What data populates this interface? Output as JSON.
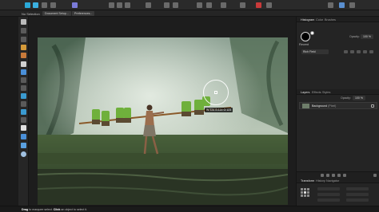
{
  "toolbar": {
    "icons": [
      "photo-persona-icon",
      "liquify-persona-icon",
      "develop-persona-icon",
      "tone-mapping-persona-icon",
      "export-persona-icon"
    ],
    "accent_color": "#2aa9d8"
  },
  "context": {
    "selection_label": "No Selection",
    "document_setup_label": "Document Setup...",
    "preferences_label": "Preferences..."
  },
  "canvas": {
    "brush_readout": "W:334 B:114 G:123"
  },
  "color_panel": {
    "tabs": [
      "Histogram",
      "Color",
      "Brushes"
    ],
    "opacity_label": "Opacity:",
    "opacity_value": "100 %",
    "recent_label": "Recent",
    "palette_name": "Rich Field"
  },
  "layers_panel": {
    "tabs": [
      "Layers",
      "Effects",
      "Styles"
    ],
    "opacity_label": "Opacity:",
    "opacity_value": "100 %",
    "layer_name": "Background",
    "layer_kind": "(Pixel)"
  },
  "transform_panel": {
    "tabs": [
      "Transform",
      "History",
      "Navigator"
    ]
  },
  "status": {
    "drag": "Drag",
    "drag_desc": "to marquee select.",
    "click": "Click",
    "click_desc": "an object to select it."
  }
}
